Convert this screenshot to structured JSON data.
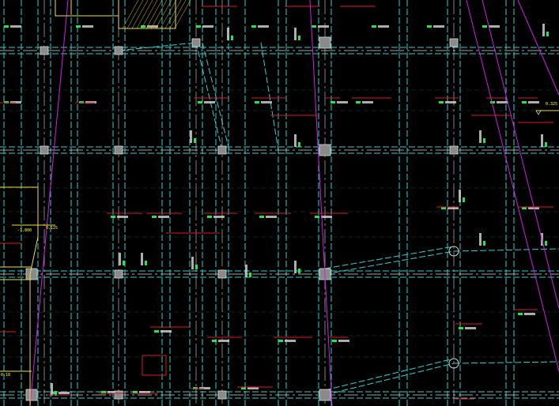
{
  "colors": {
    "background": "#000000",
    "grid_cyan": "#2fd0d0",
    "beam_white": "#d8d8d8",
    "column_fill": "#8a8a8a",
    "magenta": "#d21ee8",
    "red": "#e0182a",
    "yellow": "#f0e040",
    "green": "#22ff55"
  },
  "annotations": {
    "level_right": "0.325",
    "level_left": "-1.800",
    "level_left_small": "0.125",
    "level_bottom_left": "0.18"
  }
}
